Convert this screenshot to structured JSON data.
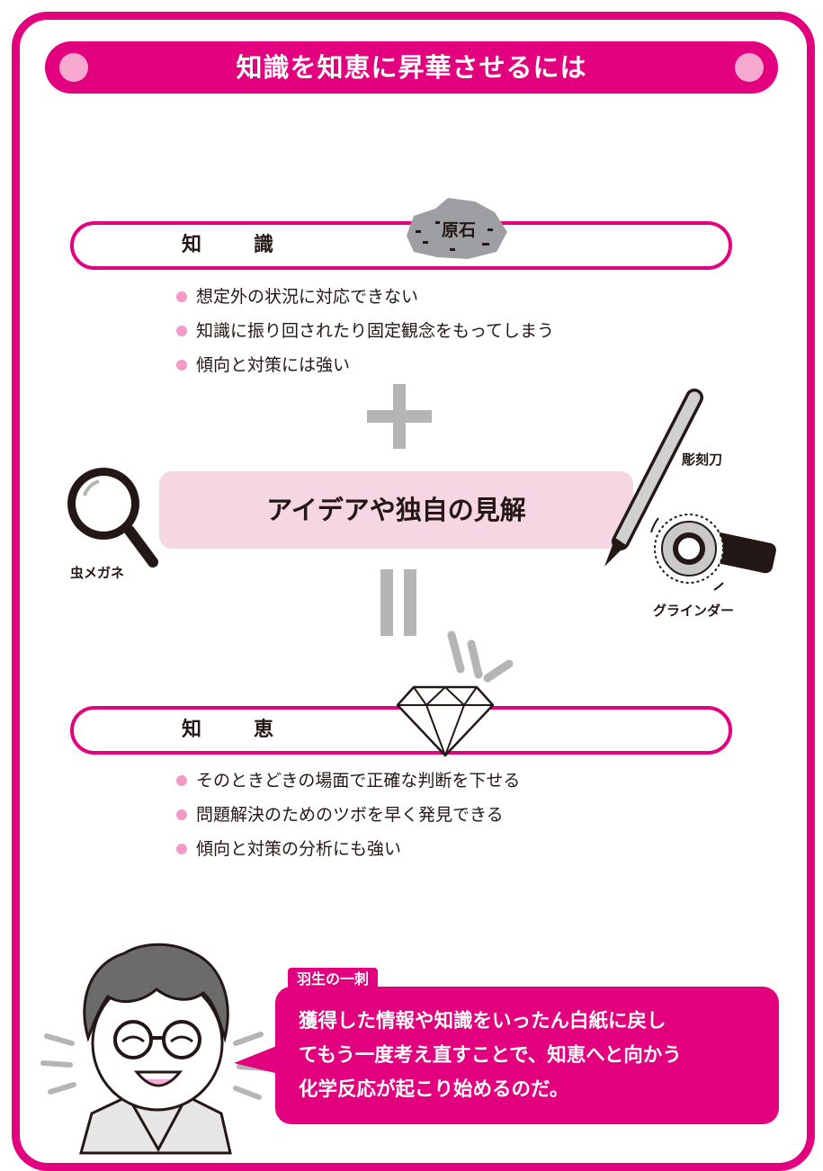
{
  "title": "知識を知恵に昇華させるには",
  "knowledge": {
    "label": "知　識",
    "stone_label": "原石",
    "bullets": [
      "想定外の状況に対応できない",
      "知識に振り回されたり固定観念をもってしまう",
      "傾向と対策には強い"
    ]
  },
  "idea": {
    "label": "アイデアや独自の見解"
  },
  "tools": {
    "magnifier_label": "虫メガネ",
    "knife_label": "彫刻刀",
    "grinder_label": "グラインダー"
  },
  "wisdom": {
    "label": "知　恵",
    "bullets": [
      "そのときどきの場面で正確な判断を下せる",
      "問題解決のためのツボを早く発見できる",
      "傾向と対策の分析にも強い"
    ]
  },
  "callout": {
    "title": "羽生の一刺",
    "lines": [
      "獲得した情報や知識をいったん白紙に戻し",
      "てもう一度考え直すことで、知恵へと向かう",
      "化学反応が起こり始めるのだ。"
    ]
  },
  "colors": {
    "accent": "#e3007f",
    "accent_light": "#f6d6e3",
    "bullet": "#f39ac6",
    "gray": "#b5b5b6"
  },
  "icons": [
    "magnifier-icon",
    "knife-icon",
    "grinder-icon",
    "diamond-icon",
    "stone-icon",
    "man-icon"
  ]
}
